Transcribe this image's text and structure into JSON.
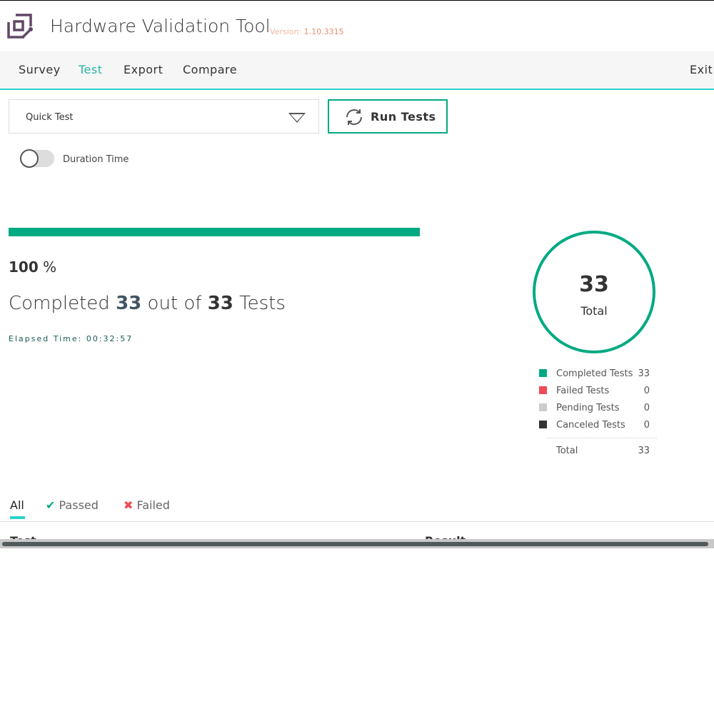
{
  "app": {
    "title": "Hardware Validation Tool",
    "version_label": "Version:",
    "version": "1.10.3315"
  },
  "nav": {
    "items": [
      "Survey",
      "Test",
      "Export",
      "Compare"
    ],
    "active": "Test",
    "exit": "Exit"
  },
  "controls": {
    "test_type": "Quick Test",
    "run_label": "Run Tests",
    "duration_label": "Duration Time",
    "duration_on": false
  },
  "progress": {
    "percent": 100,
    "percent_value": "100",
    "percent_sign": "%",
    "completed_prefix": "Completed",
    "completed": "33",
    "out_of": "out of",
    "total": "33",
    "tests_word": "Tests",
    "elapsed": "Elapsed Time: 00:32:57"
  },
  "summary": {
    "total": "33",
    "total_label": "Total",
    "legend": [
      {
        "label": "Completed Tests",
        "value": "33",
        "color": "#01a982"
      },
      {
        "label": "Failed Tests",
        "value": "0",
        "color": "#f04953"
      },
      {
        "label": "Pending Tests",
        "value": "0",
        "color": "#cccccc"
      },
      {
        "label": "Canceled Tests",
        "value": "0",
        "color": "#333333"
      }
    ],
    "total_row": {
      "label": "Total",
      "value": "33"
    }
  },
  "filters": {
    "tabs": [
      "All",
      "Passed",
      "Failed"
    ],
    "active": "All"
  },
  "table": {
    "columns": [
      "Test",
      "Result"
    ]
  }
}
